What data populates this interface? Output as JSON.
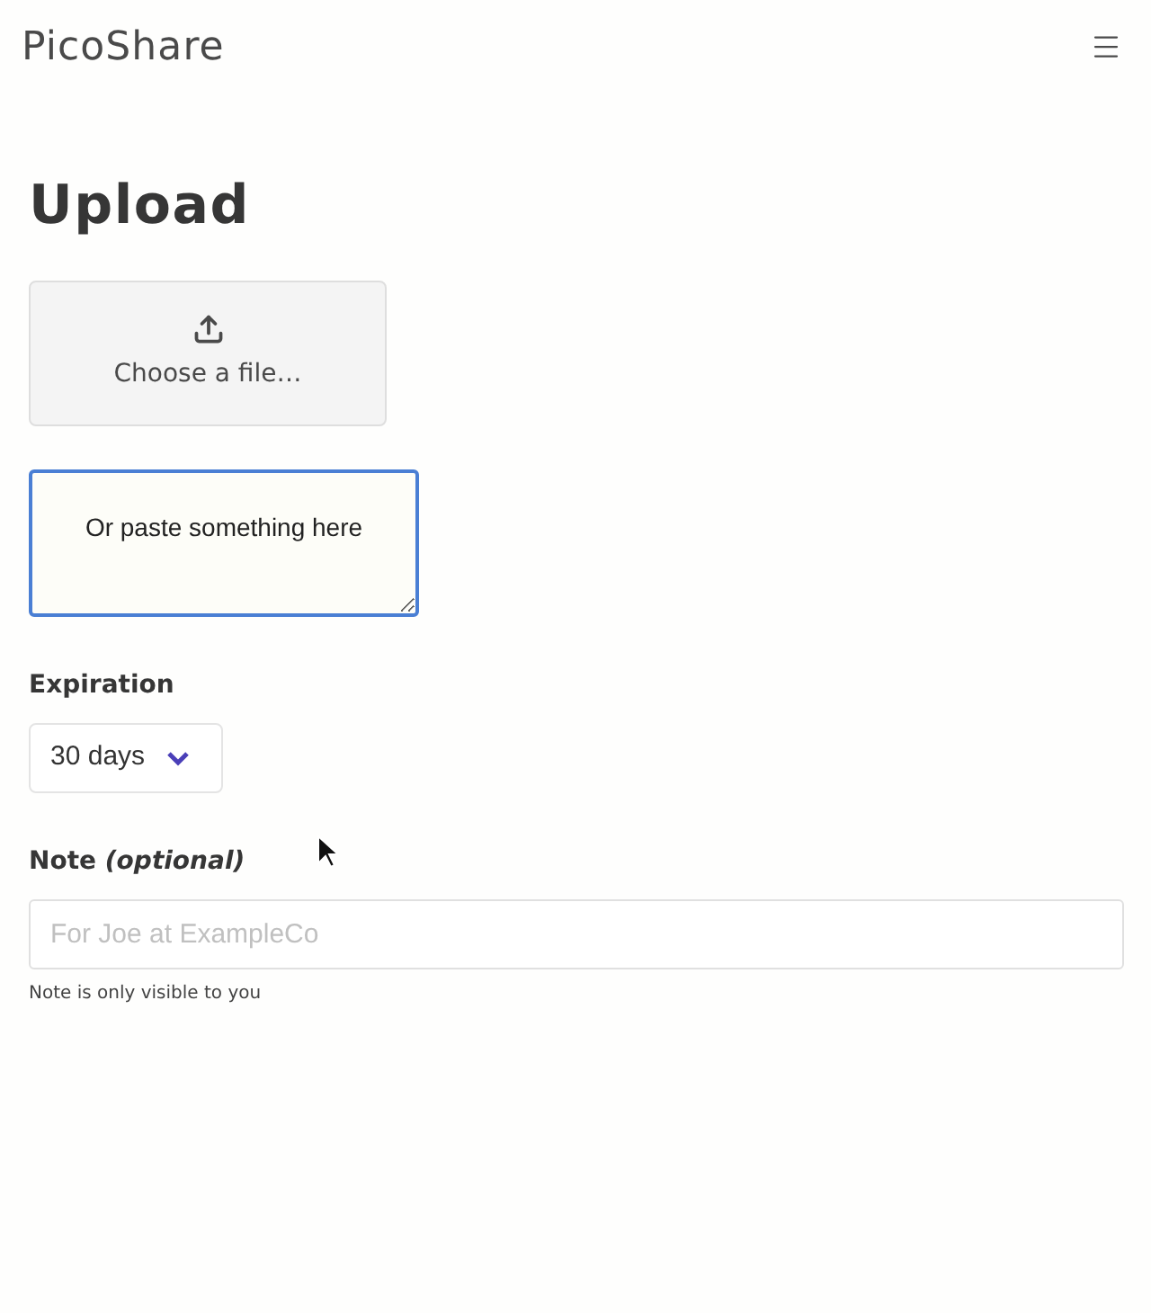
{
  "navbar": {
    "brand": "PicoShare"
  },
  "page": {
    "title": "Upload"
  },
  "file_button": {
    "label": "Choose a file…"
  },
  "paste_box": {
    "placeholder": "Or paste something here",
    "focused": true
  },
  "expiration": {
    "label": "Expiration",
    "value": "30 days"
  },
  "note": {
    "label": "Note *(optional)*",
    "placeholder": "For Joe at ExampleCo",
    "help": "Note is only visible to you"
  }
}
